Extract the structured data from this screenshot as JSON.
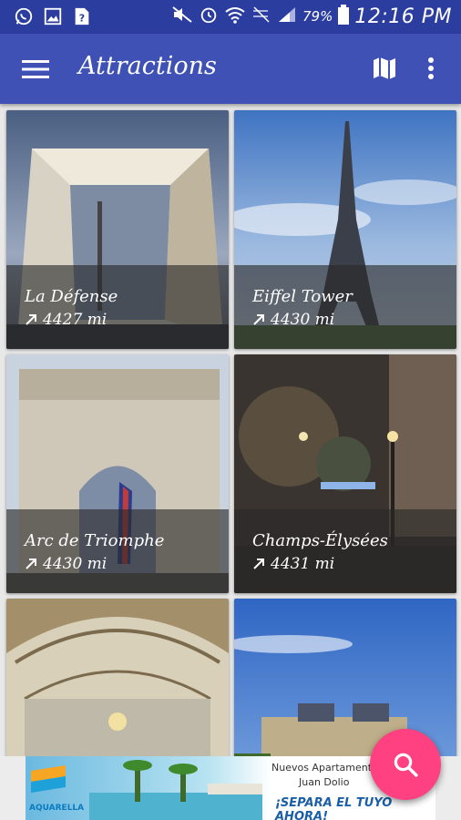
{
  "status_bar": {
    "battery": "79%",
    "time": "12:16 PM"
  },
  "app_bar": {
    "title": "Attractions"
  },
  "attractions": [
    {
      "name": "La Défense",
      "distance": "4427 mi"
    },
    {
      "name": "Eiffel Tower",
      "distance": "4430 mi"
    },
    {
      "name": "Arc de Triomphe",
      "distance": "4430 mi"
    },
    {
      "name": "Champs-Élysées",
      "distance": "4431 mi"
    },
    {
      "name": "",
      "distance": ""
    },
    {
      "name": "",
      "distance": ""
    }
  ],
  "ad": {
    "brand": "AQUARELLA",
    "line1": "Nuevos Apartamentos",
    "line2": "Juan Dolio",
    "line3": "¡SEPARA EL TUYO AHORA!"
  },
  "colors": {
    "primary": "#3f51b5",
    "primary_dark": "#2c3da0",
    "accent": "#ff4081"
  },
  "icons": {
    "menu": "menu-icon",
    "map": "map-icon",
    "more": "more-vert-icon",
    "search": "search-icon",
    "distance": "north-east-arrow-icon"
  }
}
